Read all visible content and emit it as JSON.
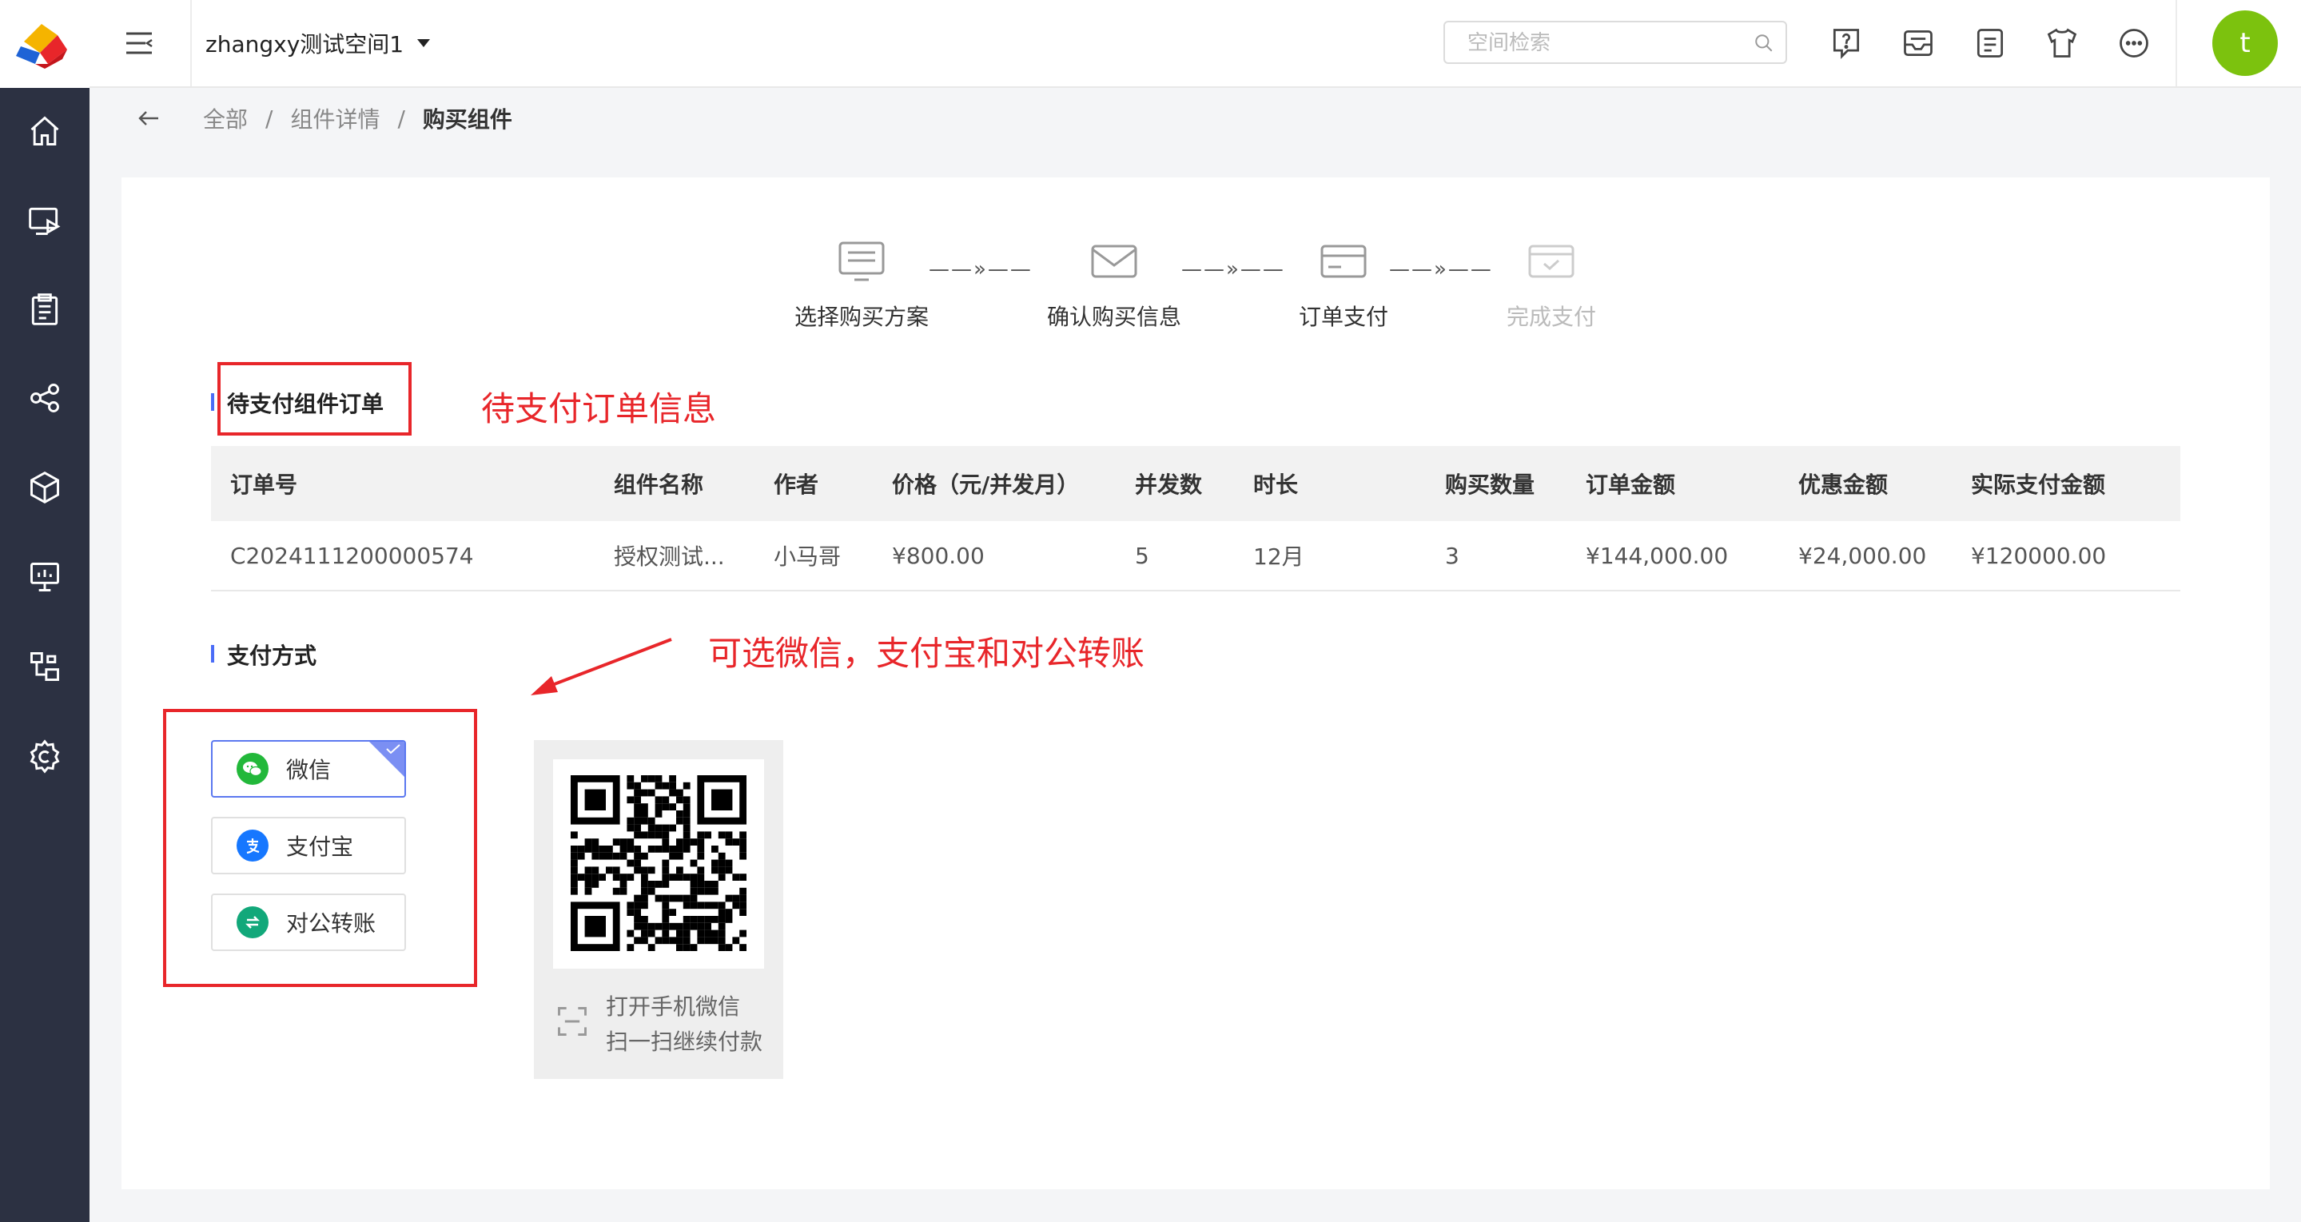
{
  "topbar": {
    "workspace_name": "zhangxy测试空间1",
    "search_placeholder": "空间检索",
    "avatar_letter": "t",
    "avatar_color": "#7cc20e"
  },
  "breadcrumb": {
    "items": [
      "全部",
      "组件详情",
      "购买组件"
    ],
    "separator": "/"
  },
  "steps": [
    {
      "label": "选择购买方案",
      "icon": "screen-icon",
      "state": "done"
    },
    {
      "label": "确认购买信息",
      "icon": "envelope-icon",
      "state": "done"
    },
    {
      "label": "订单支付",
      "icon": "card-icon",
      "state": "current"
    },
    {
      "label": "完成支付",
      "icon": "check-card-icon",
      "state": "pending"
    }
  ],
  "order_section": {
    "title": "待支付组件订单",
    "columns": [
      "订单号",
      "组件名称",
      "作者",
      "价格（元/并发月）",
      "并发数",
      "时长",
      "购买数量",
      "订单金额",
      "优惠金额",
      "实际支付金额"
    ],
    "rows": [
      [
        "C2024111200000574",
        "授权测试...",
        "小马哥",
        "¥800.00",
        "5",
        "12月",
        "3",
        "¥144,000.00",
        "¥24,000.00",
        "¥120000.00"
      ]
    ]
  },
  "payment_section": {
    "title": "支付方式",
    "options": [
      {
        "label": "微信",
        "icon": "wechat-icon",
        "color": "#22b83a",
        "selected": true
      },
      {
        "label": "支付宝",
        "icon": "alipay-icon",
        "color": "#1677ff",
        "selected": false
      },
      {
        "label": "对公转账",
        "icon": "transfer-icon",
        "color": "#12a87a",
        "selected": false
      }
    ],
    "qr_hint_line1": "打开手机微信",
    "qr_hint_line2": "扫一扫继续付款"
  },
  "annotations": {
    "order_note": "待支付订单信息",
    "payment_note": "可选微信，支付宝和对公转账",
    "color": "#e8262a"
  },
  "accent_color": "#5b78f0"
}
